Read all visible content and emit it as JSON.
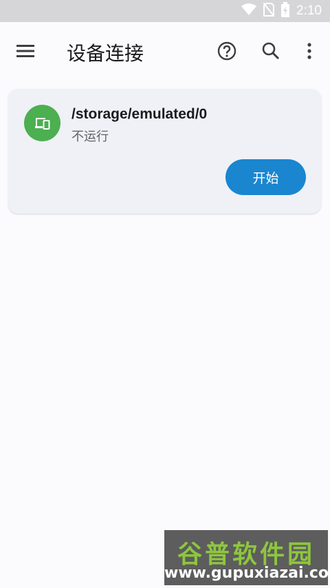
{
  "status_bar": {
    "time": "2:10",
    "icons": [
      "wifi-icon",
      "no-sim-icon",
      "battery-charging-icon"
    ]
  },
  "app_bar": {
    "title": "设备连接",
    "icons": [
      "menu-icon",
      "help-icon",
      "search-icon",
      "more-vert-icon"
    ]
  },
  "device_card": {
    "path": "/storage/emulated/0",
    "status": "不运行",
    "start_label": "开始",
    "icon": "devices-icon",
    "avatar_color": "#4caf50",
    "button_color": "#1a86d0"
  },
  "watermark": {
    "brand": "谷普软件园",
    "url": "www.gupuxiazai.com"
  }
}
